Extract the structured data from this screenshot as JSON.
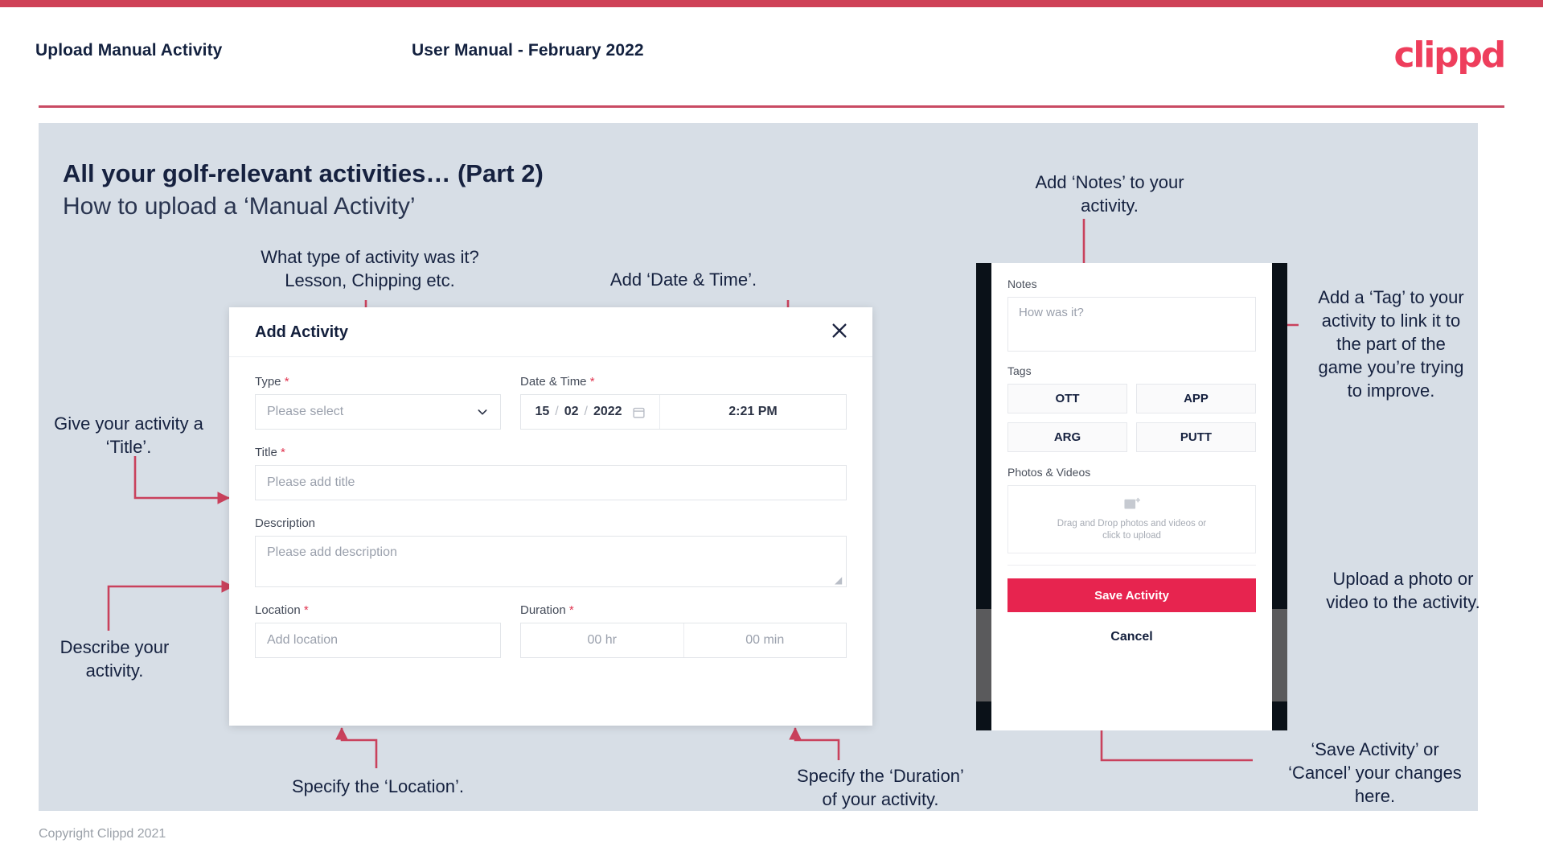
{
  "header": {
    "left_title": "Upload Manual Activity",
    "center_title": "User Manual - February 2022",
    "logo": "clippd"
  },
  "slide": {
    "title": "All your golf-relevant activities… (Part 2)",
    "subtitle": "How to upload a ‘Manual Activity’"
  },
  "annotations": {
    "type": "What type of activity was it?\nLesson, Chipping etc.",
    "datetime": "Add ‘Date & Time’.",
    "title": "Give your activity a\n‘Title’.",
    "description": "Describe your\nactivity.",
    "location": "Specify the ‘Location’.",
    "duration": "Specify the ‘Duration’\nof your activity.",
    "notes": "Add ‘Notes’ to your\nactivity.",
    "tags": "Add a ‘Tag’ to your\nactivity to link it to\nthe part of the\ngame you’re trying\nto improve.",
    "upload": "Upload a photo or\nvideo to the activity.",
    "save_cancel": "‘Save Activity’ or\n‘Cancel’ your changes\nhere."
  },
  "dialog": {
    "title": "Add Activity",
    "close_label": "×",
    "fields": {
      "type": {
        "label": "Type",
        "required": "*",
        "value": "Please select"
      },
      "datetime": {
        "label": "Date & Time",
        "required": "*",
        "day": "15",
        "month": "02",
        "year": "2022",
        "sep1": "/",
        "sep2": "/",
        "time": "2:21 PM"
      },
      "title": {
        "label": "Title",
        "required": "*",
        "placeholder": "Please add title"
      },
      "description": {
        "label": "Description",
        "required": "",
        "placeholder": "Please add description"
      },
      "location": {
        "label": "Location",
        "required": "*",
        "placeholder": "Add location"
      },
      "duration": {
        "label": "Duration",
        "required": "*",
        "hours": "00 hr",
        "minutes": "00 min"
      }
    }
  },
  "phone": {
    "notes_label": "Notes",
    "notes_placeholder": "How was it?",
    "tags_label": "Tags",
    "tags": [
      "OTT",
      "APP",
      "ARG",
      "PUTT"
    ],
    "photos_label": "Photos & Videos",
    "drop_text": "Drag and Drop photos and videos or\nclick to upload",
    "save_button": "Save Activity",
    "cancel_button": "Cancel"
  },
  "footer": {
    "copyright": "Copyright Clippd 2021"
  },
  "colors": {
    "accent": "#cf4257",
    "brand_pink": "#ee3e5c",
    "save_button": "#e7244f",
    "canvas_bg": "#d7dee6",
    "text_dark": "#15213f",
    "connector": "#c9415c"
  }
}
